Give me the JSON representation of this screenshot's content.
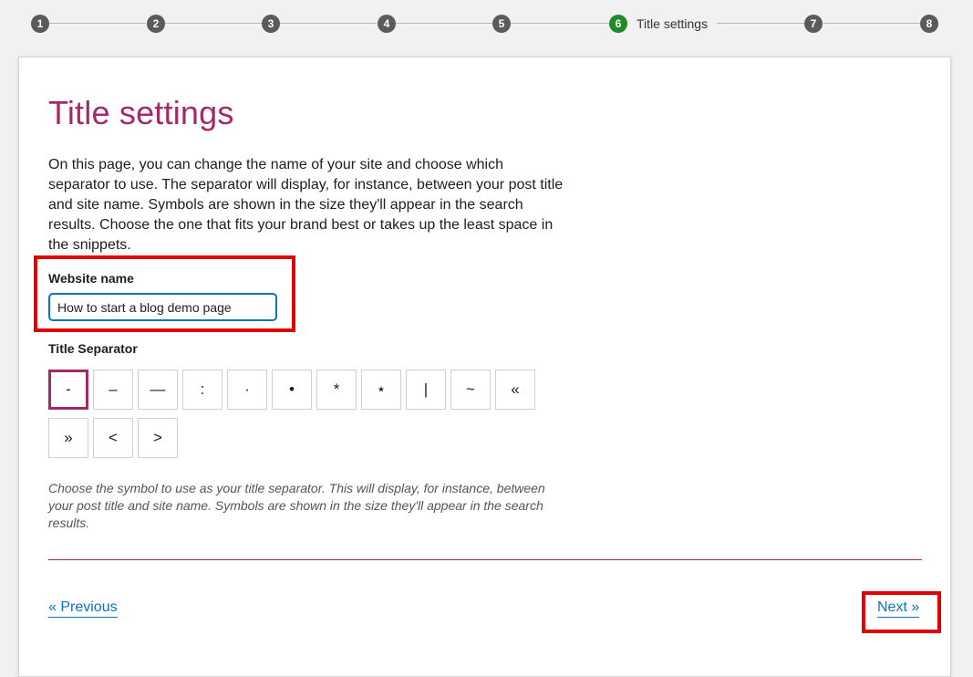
{
  "stepper": {
    "steps": [
      {
        "number": "1"
      },
      {
        "number": "2"
      },
      {
        "number": "3"
      },
      {
        "number": "4"
      },
      {
        "number": "5"
      },
      {
        "number": "6",
        "label": "Title settings"
      },
      {
        "number": "7"
      },
      {
        "number": "8"
      }
    ],
    "active_step": 6,
    "active_color": "#1f8b2d",
    "inactive_color": "#5b5b5b"
  },
  "page": {
    "title": "Title settings",
    "intro": "On this page, you can change the name of your site and choose which separator to use. The separator will display, for instance, between your post title and site name. Symbols are shown in the size they'll appear in the search results. Choose the one that fits your brand best or takes up the least space in the snippets.",
    "title_color": "#a4286a"
  },
  "website_name": {
    "label": "Website name",
    "value": "How to start a blog demo page"
  },
  "separator": {
    "label": "Title Separator",
    "options": [
      "-",
      "–",
      "—",
      ":",
      "·",
      "•",
      "*",
      "⋆",
      "|",
      "~",
      "«",
      "»",
      "<",
      ">"
    ],
    "selected": "-",
    "help": "Choose the symbol to use as your title separator. This will display, for instance, between your post title and site name. Symbols are shown in the size they'll appear in the search results."
  },
  "navigation": {
    "previous_label": "« Previous",
    "next_label": "Next »",
    "link_color": "#0a74bb"
  },
  "annotation": {
    "highlight_color": "#e30000"
  }
}
